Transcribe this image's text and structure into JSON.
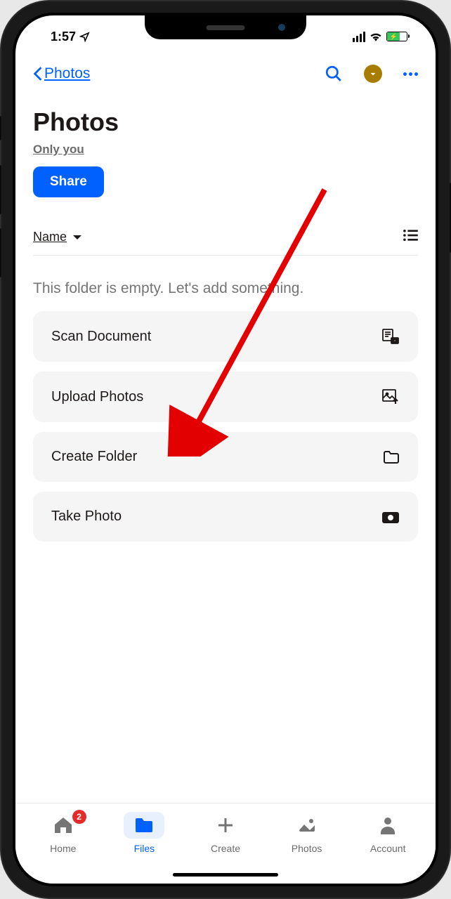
{
  "status": {
    "time": "1:57"
  },
  "nav": {
    "back_label": "Photos"
  },
  "header": {
    "title": "Photos",
    "subtitle": "Only you",
    "share_label": "Share"
  },
  "sort": {
    "label": "Name"
  },
  "empty": {
    "message": "This folder is empty. Let's add something."
  },
  "actions": [
    {
      "label": "Scan Document",
      "icon": "scan-document-icon"
    },
    {
      "label": "Upload Photos",
      "icon": "upload-photo-icon"
    },
    {
      "label": "Create Folder",
      "icon": "folder-icon"
    },
    {
      "label": "Take Photo",
      "icon": "camera-icon"
    }
  ],
  "tabs": {
    "home": {
      "label": "Home",
      "badge": "2"
    },
    "files": {
      "label": "Files"
    },
    "create": {
      "label": "Create"
    },
    "photos": {
      "label": "Photos"
    },
    "account": {
      "label": "Account"
    }
  }
}
